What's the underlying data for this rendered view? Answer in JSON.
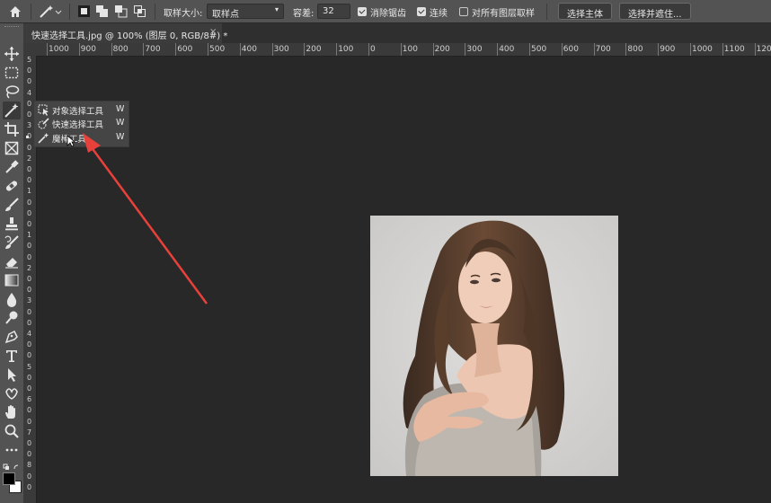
{
  "options_bar": {
    "sample_size_label": "取样大小:",
    "sample_size_value": "取样点",
    "tolerance_label": "容差:",
    "tolerance_value": "32",
    "anti_alias_label": "消除锯齿",
    "anti_alias_checked": true,
    "contiguous_label": "连续",
    "contiguous_checked": true,
    "sample_all_layers_label": "对所有图层取样",
    "sample_all_layers_checked": false,
    "select_subject_button": "选择主体",
    "select_and_mask_button": "选择并遮住..."
  },
  "document_tab": {
    "title": "快速选择工具.jpg @ 100% (图层 0, RGB/8#) *",
    "close_glyph": "×"
  },
  "rulers": {
    "horizontal_ticks": [
      "1000",
      "900",
      "800",
      "700",
      "600",
      "500",
      "400",
      "300",
      "200",
      "100",
      "0",
      "100",
      "200",
      "300",
      "400",
      "500",
      "600",
      "700",
      "800",
      "900",
      "1000",
      "1100",
      "1200"
    ],
    "vertical_ticks": [
      "5",
      "0",
      "0",
      "4",
      "0",
      "0",
      "3",
      "0",
      "0",
      "2",
      "0",
      "0",
      "1",
      "0",
      "0",
      "0",
      "1",
      "0",
      "0",
      "2",
      "0",
      "0",
      "3",
      "0",
      "0",
      "4",
      "0",
      "0",
      "5",
      "0",
      "0",
      "6",
      "0",
      "0",
      "7",
      "0",
      "0",
      "8",
      "0",
      "0"
    ]
  },
  "tool_flyout": {
    "items": [
      {
        "label": "对象选择工具",
        "shortcut": "W",
        "icon": "object-selection-icon",
        "current": false
      },
      {
        "label": "快速选择工具",
        "shortcut": "W",
        "icon": "quick-selection-icon",
        "current": false
      },
      {
        "label": "魔棒工具",
        "shortcut": "W",
        "icon": "magic-wand-icon",
        "current": true
      }
    ]
  },
  "toolbar": {
    "tools": [
      "move-tool-icon",
      "marquee-tool-icon",
      "lasso-tool-icon",
      "magic-wand-tool-icon",
      "crop-tool-icon",
      "frame-tool-icon",
      "eyedropper-tool-icon",
      "healing-brush-tool-icon",
      "brush-tool-icon",
      "clone-stamp-tool-icon",
      "history-brush-tool-icon",
      "eraser-tool-icon",
      "gradient-tool-icon",
      "blur-tool-icon",
      "dodge-tool-icon",
      "pen-tool-icon",
      "type-tool-icon",
      "path-selection-tool-icon",
      "custom-shape-tool-icon",
      "hand-tool-icon",
      "zoom-tool-icon",
      "more-tools-icon"
    ],
    "foreground_color": "#000000",
    "background_color": "#ffffff"
  },
  "colors": {
    "canvas_background": "#282828",
    "panel": "#535353",
    "annotation_arrow": "#e8413c"
  }
}
